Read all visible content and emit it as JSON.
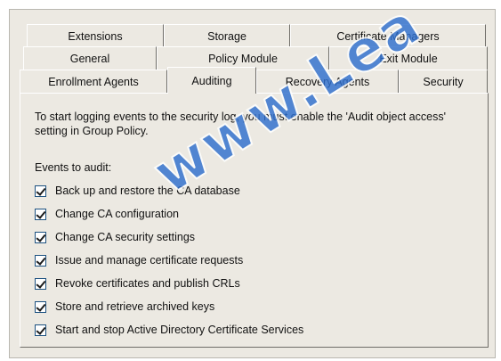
{
  "tabs": {
    "row1": [
      {
        "label": "Extensions"
      },
      {
        "label": "Storage"
      },
      {
        "label": "Certificate Managers"
      }
    ],
    "row2": [
      {
        "label": "General"
      },
      {
        "label": "Policy Module"
      },
      {
        "label": "Exit Module"
      }
    ],
    "row3": [
      {
        "label": "Enrollment Agents"
      },
      {
        "label": "Auditing"
      },
      {
        "label": "Recovery Agents"
      },
      {
        "label": "Security"
      }
    ],
    "active": "Auditing"
  },
  "panel": {
    "intro": "To start logging events to the security log, you must enable the 'Audit object access' setting in Group Policy.",
    "events_label": "Events to audit:",
    "events": [
      {
        "label": "Back up and restore the CA database",
        "checked": true
      },
      {
        "label": "Change CA configuration",
        "checked": true
      },
      {
        "label": "Change CA security settings",
        "checked": true
      },
      {
        "label": "Issue and manage certificate requests",
        "checked": true
      },
      {
        "label": "Revoke certificates and publish CRLs",
        "checked": true
      },
      {
        "label": "Store and retrieve archived keys",
        "checked": true
      },
      {
        "label": "Start and stop Active Directory Certificate Services",
        "checked": true
      }
    ]
  },
  "watermark": {
    "text": "www.Lea",
    "color": "#3070ce"
  }
}
